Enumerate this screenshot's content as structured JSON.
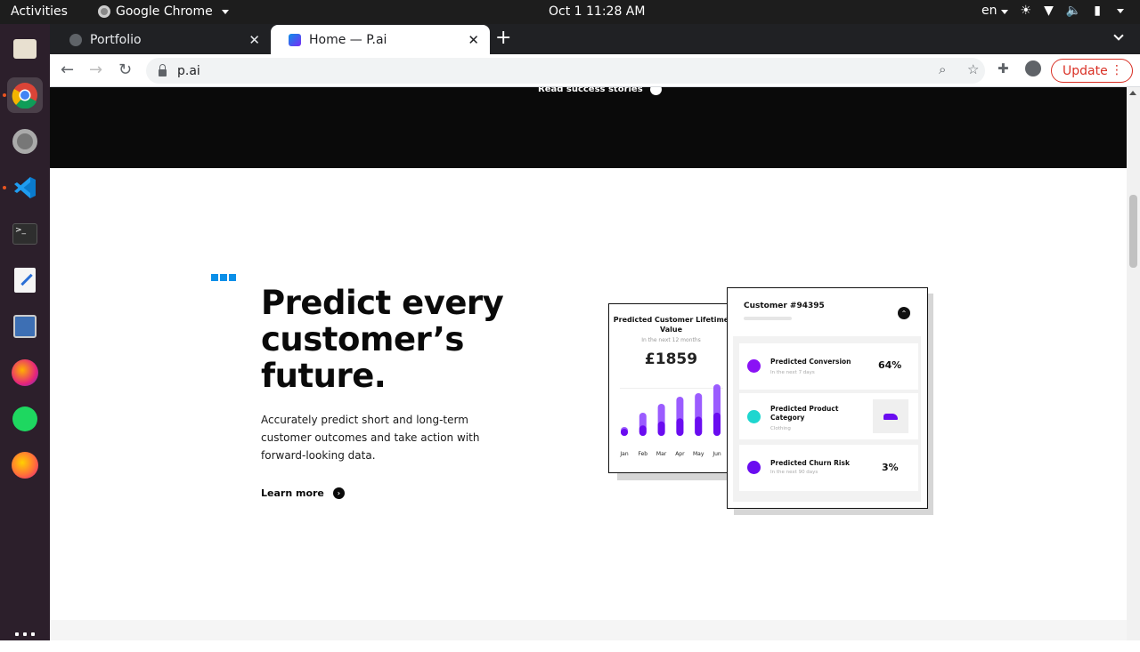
{
  "topbar": {
    "activities": "Activities",
    "app_name": "Google Chrome",
    "clock": "Oct 1  11:28 AM",
    "lang": "en"
  },
  "dock": {
    "icons": [
      "files-icon",
      "chrome-icon",
      "settings-icon",
      "vscode-icon",
      "terminal-icon",
      "text-editor-icon",
      "screenshot-icon",
      "firefox-dev-icon",
      "spotify-icon",
      "firefox-icon",
      "show-apps-icon"
    ]
  },
  "browser": {
    "tabs": [
      {
        "title": "Portfolio",
        "active": false
      },
      {
        "title": "Home — P.ai",
        "active": true
      }
    ],
    "url": "p.ai",
    "update_label": "Update"
  },
  "page": {
    "top_link": "Read success stories",
    "headline": "Predict every customer’s future.",
    "description": "Accurately predict short and long-term customer outcomes and take action with forward-looking data.",
    "learn_more": "Learn more",
    "ltv_card": {
      "title": "Predicted Customer Lifetime Value",
      "subtitle": "In the next 12 months",
      "value": "£1859",
      "months": [
        "Jan",
        "Feb",
        "Mar",
        "Apr",
        "May",
        "Jun"
      ]
    },
    "customer_card": {
      "title": "Customer #94395",
      "rows": [
        {
          "label": "Predicted Conversion",
          "sub": "In the next 7 days",
          "value": "64%",
          "color": "#8a12f5"
        },
        {
          "label": "Predicted Product Category",
          "sub": "Clothing",
          "value": "",
          "color": "#1ed6cf"
        },
        {
          "label": "Predicted Churn Risk",
          "sub": "In the next 90 days",
          "value": "3%",
          "color": "#6a0cf0"
        }
      ]
    }
  },
  "colors": {
    "accent_blue": "#0b8fe8",
    "purple": "#7a2cf5",
    "dark": "#0a0a0a"
  }
}
